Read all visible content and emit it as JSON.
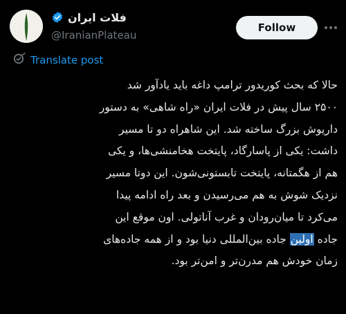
{
  "author": {
    "display_name": "فلات ایران",
    "handle": "@IranianPlateau",
    "verified": true
  },
  "header": {
    "follow_label": "Follow"
  },
  "translate": {
    "label": "Translate post"
  },
  "post": {
    "lines": [
      "حالا که بحث کوریدور ترامپ داغه باید یادآور شد",
      "۲۵۰۰ سال پیش در فلات ایران «راه شاهی» به دستور",
      "داریوش بزرگ ساخته شد. این شاهراه دو تا مسیر",
      "داشت: یکی از پاسارگاد، پایتخت هخامنشی‌ها، و یکی",
      "هم از هگمتانه، پایتخت تابستونی‌شون. این دوتا مسیر",
      "نزدیک شوش به هم می‌رسیدن و بعد راه ادامه پیدا",
      "می‌کرد تا میان‌رودان و غرب آناتولی. اون موقع این"
    ],
    "line8_start": "جاده ",
    "line8_highlight": "اولین",
    "line8_end": " جاده بین‌المللی دنیا بود و از همه جاده‌های",
    "line9": "زمان خودش هم مدرن‌تر و امن‌تر بود."
  },
  "colors": {
    "background": "#000000",
    "text": "#e7e9ea",
    "muted": "#71767b",
    "link": "#1d9bf0",
    "follow_bg": "#eff3f4",
    "highlight": "#2e6fb4"
  },
  "icons": {
    "verified": "verified-badge-icon",
    "translate": "translate-icon",
    "more": "more-options-icon"
  }
}
